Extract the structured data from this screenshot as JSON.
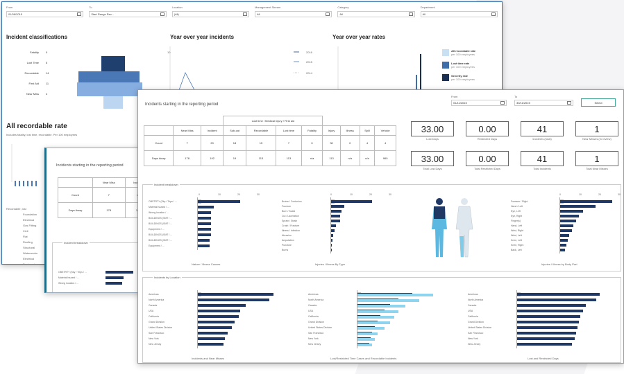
{
  "filters_p1": [
    {
      "label": "From",
      "value": "01/06/2015"
    },
    {
      "label": "To",
      "value": "Start Range Rev..."
    },
    {
      "label": "Location",
      "value": "(All)"
    },
    {
      "label": "Management Stream",
      "value": "All"
    },
    {
      "label": "Category",
      "value": "All"
    },
    {
      "label": "Department",
      "value": "All"
    }
  ],
  "p1": {
    "incident_title": "Incident classifications",
    "yoy_title": "Year over year incidents",
    "rates_title": "Year over year rates",
    "classifications": [
      {
        "label": "Fatality",
        "value": "0"
      },
      {
        "label": "Lost Time",
        "value": "5"
      },
      {
        "label": "Recordable",
        "value": "14"
      },
      {
        "label": "First Aid",
        "value": "11"
      },
      {
        "label": "Near Miss",
        "value": "4"
      }
    ],
    "yoy_legend": [
      "2016",
      "2015",
      "2014"
    ],
    "rates_legend": [
      {
        "title": "All recordable rate",
        "sub": "per 100 employees",
        "color": "#c9dff2"
      },
      {
        "title": "Lost time rate",
        "sub": "per 100 employees",
        "color": "#3f6fa8"
      },
      {
        "title": "Severity rate",
        "sub": "per 100 employees",
        "color": "#1b2f52"
      }
    ],
    "all_rate_title": "All recordable rate",
    "all_rate_sub": "Includes fatality, lost time, recordable. Per 100 employees",
    "left_labels": [
      "Recordable, lost",
      "Foundation",
      "Electrical",
      "Gas Fitting",
      "Civil",
      "Flat",
      "Roofing",
      "Structural",
      "Waterworks",
      "Electrical",
      "Engineering"
    ]
  },
  "p2": {
    "title": "Incidents starting in the reporting period",
    "headers": [
      "",
      "Near Miss",
      "Incident",
      "Fire"
    ],
    "rows": [
      [
        "Count",
        "7",
        "20",
        "18"
      ],
      [
        "Days Away",
        "178",
        "192",
        "19"
      ]
    ],
    "section": "Incident breakdown",
    "labels": [
      "OBSTRTY (Sky / Trips / ...",
      "Material hazard / ...",
      "Wrong location / ..."
    ]
  },
  "p3": {
    "title": "Incidents starting in the reporting period",
    "from_label": "From",
    "to_label": "To",
    "from_value": "01/11/2015",
    "to_value": "30/11/2015",
    "button": "Select",
    "group_header": "Lost time / Medical injury / First aid",
    "headers": [
      "",
      "Near Miss",
      "Incident",
      "Sub-cat",
      "Recordable",
      "Lost time",
      "Fatality",
      "Injury",
      "Illness",
      "Spill",
      "Vehicle"
    ],
    "rows": [
      [
        "Count",
        "7",
        "20",
        "18",
        "15",
        "7",
        "0",
        "30",
        "0",
        "4",
        "4"
      ],
      [
        "Days Away",
        "178",
        "192",
        "19",
        "113",
        "113",
        "n/a",
        "113",
        "n/a",
        "n/a",
        "960"
      ]
    ],
    "kpis": [
      {
        "value": "33.00",
        "caption": "Lost Days"
      },
      {
        "value": "0.00",
        "caption": "Restricted Days"
      },
      {
        "value": "41",
        "caption": "Incidents (total)"
      },
      {
        "value": "1",
        "caption": "Near Misses (in review)"
      },
      {
        "value": "33.00",
        "caption": "Total Lost Days"
      },
      {
        "value": "0.00",
        "caption": "Total Restricted Days"
      },
      {
        "value": "41",
        "caption": "Total Incidents"
      },
      {
        "value": "1",
        "caption": "Total Near Misses"
      }
    ],
    "section1": "Incident breakdown",
    "section2": "Incidents by Location",
    "cap_causes": "Nature / Illness Causes",
    "cap_types": "Injuries / Illness By Type",
    "cap_body": "Injuries / Illness by Body Part",
    "cap_loc1": "Incidents and Near Misses",
    "cap_loc2": "Lost/Restricted Time Cases and Recordable Incidents",
    "cap_loc3": "Lost and Restricted Days",
    "cause_labels": [
      "OBSTRTY (Sky / Trips / ...",
      "Material hazard / ...",
      "Wrong location / ...",
      "BUILDINGS (SMT / ...",
      "BUILDINGS (SMT / ...",
      "Equipment / ...",
      "BUILDINGS (SMT / ...",
      "BUILDINGS (SMT / ...",
      "Equipment / ..."
    ],
    "type_labels": [
      "Bruise / Contusion",
      "Fracture",
      "Burn / Scald",
      "Cut / Laceration",
      "Sprain / Strain",
      "Crush / Fracture",
      "Illness / Infection",
      "Abrasion",
      "Amputation",
      "Puncture",
      "Burns"
    ],
    "body_labels": [
      "Forearm / Right",
      "Hand / Left",
      "Eye, Left",
      "Eye, Right",
      "Finger(s)",
      "Hand, Left",
      "Wrist, Right",
      "Wrist, Left",
      "Knee, Left",
      "Knee, Right",
      "Back, Left"
    ],
    "loc_labels": [
      "Americas",
      "North America",
      "Canada",
      "USA",
      "California",
      "Grand Division",
      "United States Division",
      "San Francisco",
      "New York",
      "New Jersey"
    ],
    "axis_ticks": [
      "0",
      "10",
      "20",
      "30"
    ]
  }
}
